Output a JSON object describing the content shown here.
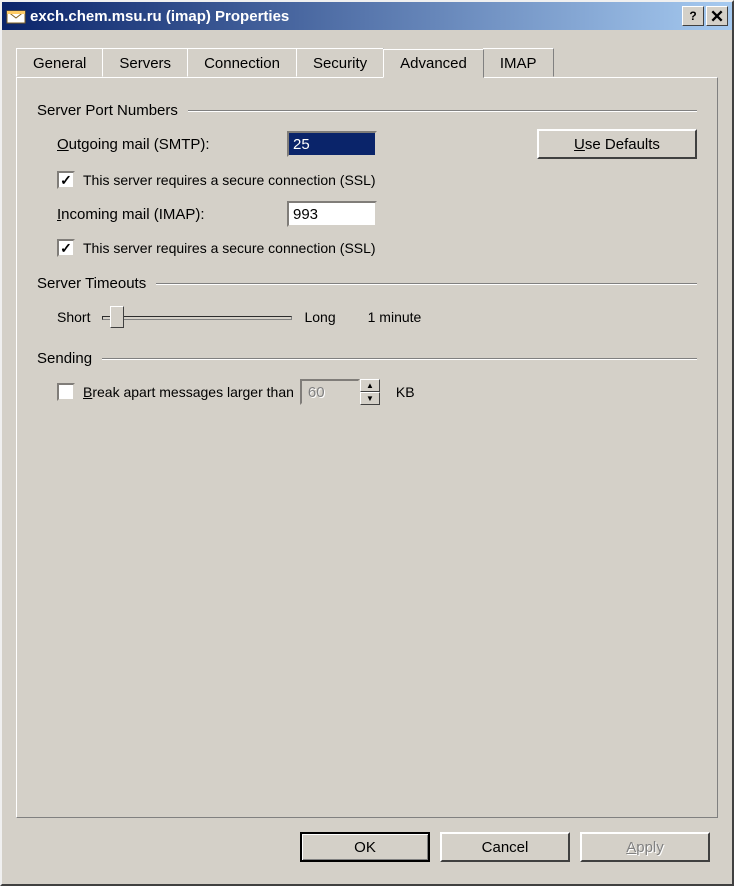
{
  "titlebar": {
    "title": "exch.chem.msu.ru (imap) Properties"
  },
  "tabs": {
    "general": "General",
    "servers": "Servers",
    "connection": "Connection",
    "security": "Security",
    "advanced": "Advanced",
    "imap": "IMAP"
  },
  "groups": {
    "server_ports": {
      "legend": "Server Port Numbers",
      "outgoing_label": "Outgoing mail (SMTP):",
      "outgoing_u": "O",
      "outgoing_value": "25",
      "use_defaults": "Use Defaults",
      "use_defaults_u": "U",
      "ssl_smtp": "This server requires a secure connection (SSL)",
      "incoming_label": "Incoming mail (IMAP):",
      "incoming_u": "I",
      "incoming_value": "993",
      "ssl_imap": "This server requires a secure connection (SSL)"
    },
    "timeouts": {
      "legend": "Server Timeouts",
      "short": "Short",
      "long": "Long",
      "value": "1 minute"
    },
    "sending": {
      "legend": "Sending",
      "break_label": "Break apart messages larger than",
      "break_u": "B",
      "break_value": "60",
      "kb": "KB"
    }
  },
  "buttons": {
    "ok": "OK",
    "cancel": "Cancel",
    "apply": "Apply",
    "apply_u": "A"
  }
}
